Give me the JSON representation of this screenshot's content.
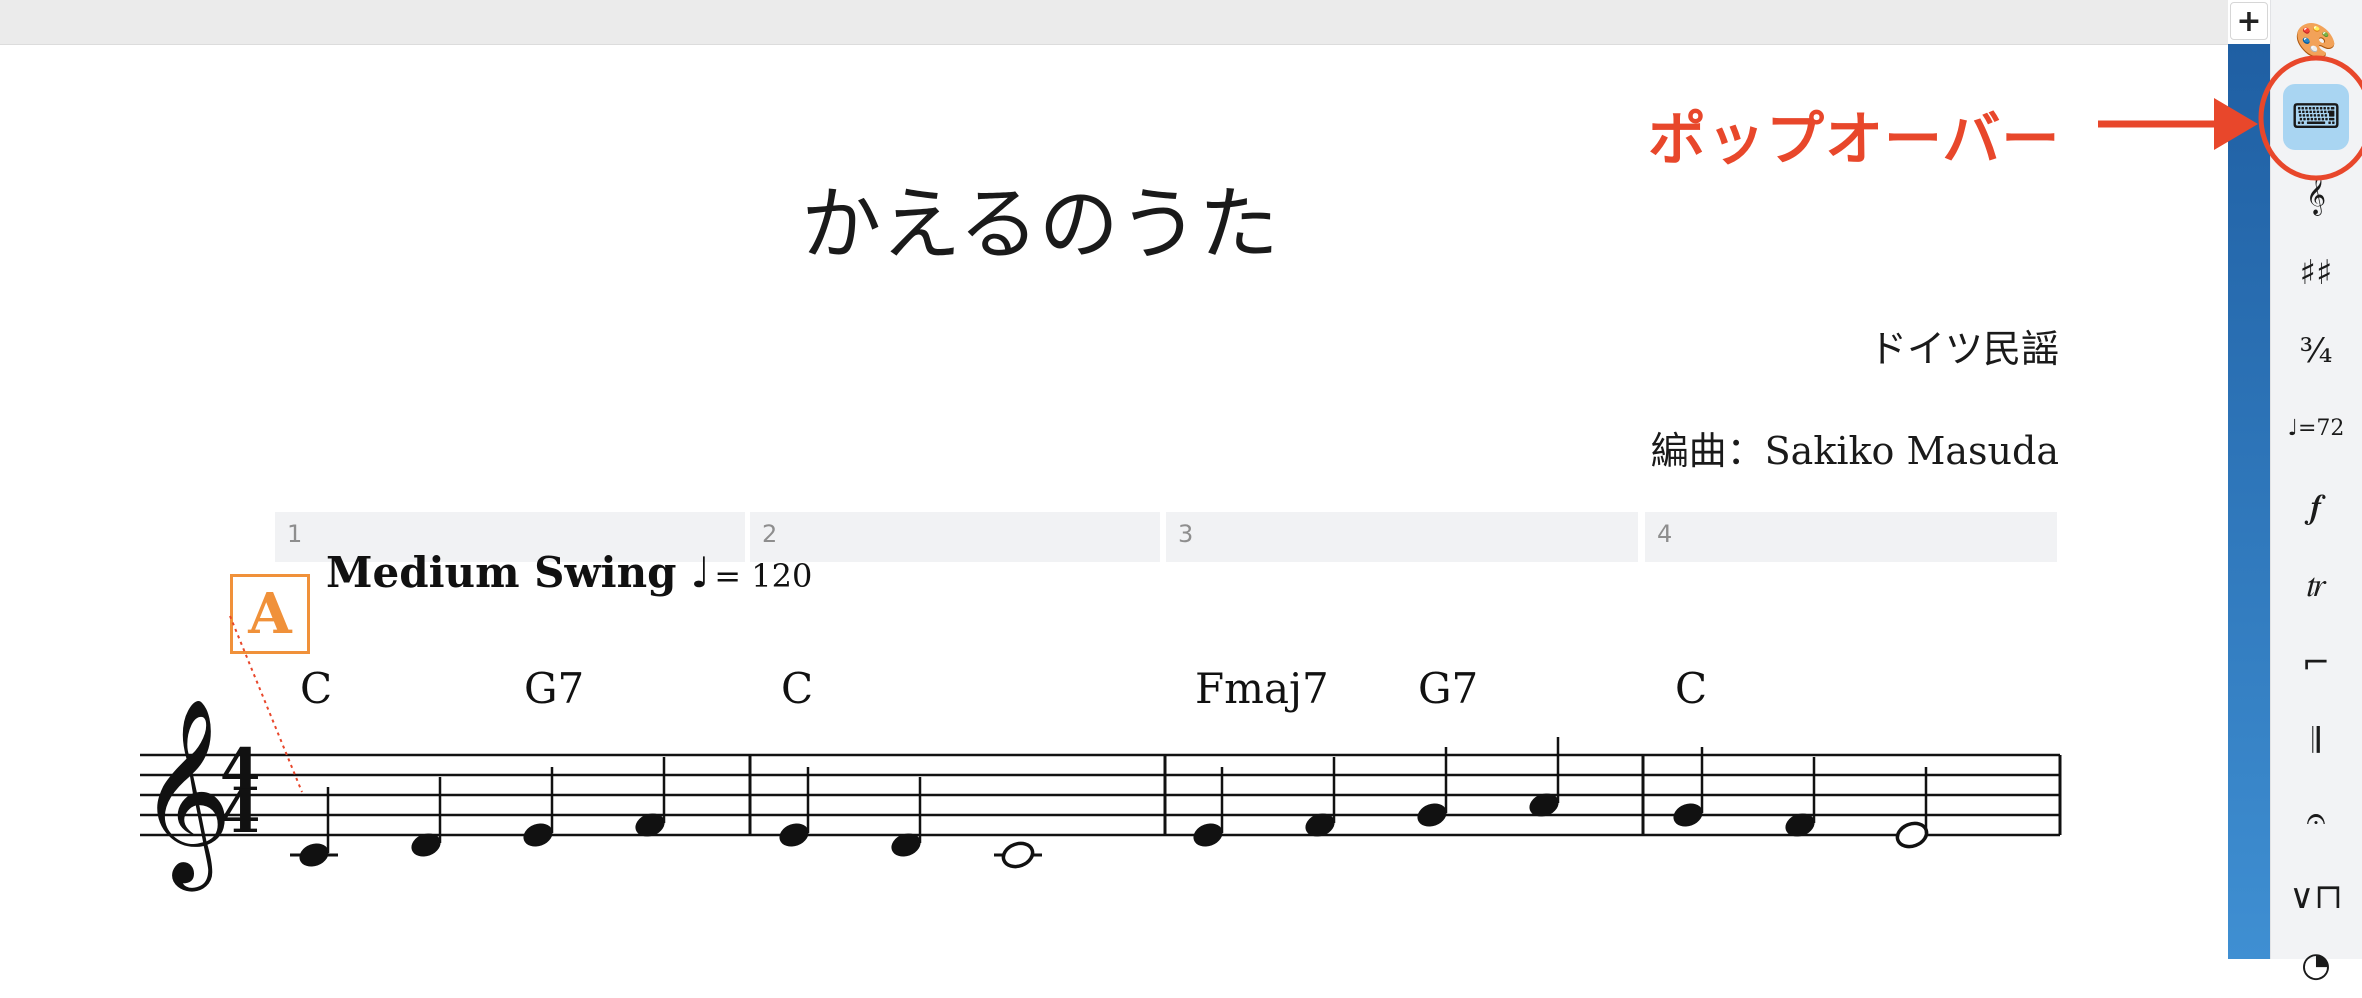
{
  "toolbar": {
    "add_label": "+",
    "tools": [
      {
        "name": "palette-icon",
        "glyph": "🎨",
        "active": false
      },
      {
        "name": "keyboard-icon",
        "glyph": "⌨",
        "active": true
      },
      {
        "name": "clef-icon",
        "glyph": "𝄞",
        "active": false
      },
      {
        "name": "key-signature-icon",
        "glyph": "♯♯",
        "active": false
      },
      {
        "name": "time-signature-icon",
        "glyph": "¾",
        "active": false
      },
      {
        "name": "tempo-icon",
        "glyph": "♩=72",
        "active": false
      },
      {
        "name": "dynamics-icon",
        "glyph": "𝆑",
        "active": false
      },
      {
        "name": "trill-icon",
        "glyph": "𝆖",
        "active": false
      },
      {
        "name": "volta-icon",
        "glyph": "⌐",
        "active": false
      },
      {
        "name": "barline-icon",
        "glyph": "𝄂",
        "active": false
      },
      {
        "name": "fermata-icon",
        "glyph": "𝄐",
        "active": false
      },
      {
        "name": "bowing-icon",
        "glyph": "∨⊓",
        "active": false
      },
      {
        "name": "pedal-icon",
        "glyph": "◔",
        "active": false
      }
    ]
  },
  "annotation": {
    "label": "ポップオーバー",
    "color": "#e8472b"
  },
  "score": {
    "title": "かえるのうた",
    "composer": "ドイツ民謡",
    "arranger": "編曲：Sakiko Masuda",
    "measure_numbers": [
      "1",
      "2",
      "3",
      "4"
    ],
    "tempo": {
      "style": "Medium Swing",
      "note": "♩",
      "text": "= 120"
    },
    "rehearsal_mark": "A",
    "chords": [
      "C",
      "G7",
      "C",
      "Fmaj7",
      "G7",
      "C"
    ],
    "time_signature": {
      "top": "4",
      "bottom": "4"
    },
    "clef": "𝄞",
    "accent_color": "#f0913a"
  }
}
